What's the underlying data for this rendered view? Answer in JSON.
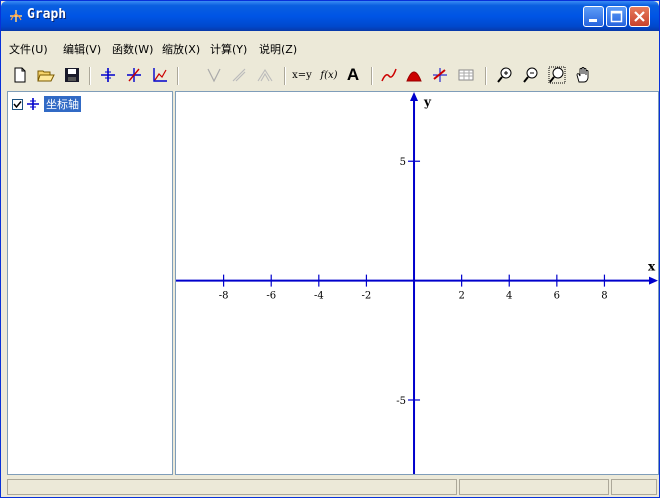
{
  "window": {
    "title": "Graph"
  },
  "menu": [
    "文件(U)",
    "编辑(V)",
    "函数(W)",
    "缩放(X)",
    "计算(Y)",
    "说明(Z)"
  ],
  "toolbar": {
    "tools": [
      "new-file-icon",
      "open-folder-icon",
      "save-icon",
      "axes-icon",
      "insert-function-icon",
      "insert-tangent-icon",
      "shade-icon",
      "inequality-icon",
      "tangent-disabled-icon",
      "series-disabled-icon",
      "xy-label",
      "fx-label",
      "text-icon",
      "trendline-icon",
      "area-icon",
      "point-series-icon",
      "table-icon",
      "zoom-in-icon",
      "zoom-out-icon",
      "zoom-fit-icon",
      "pan-hand-icon"
    ],
    "xy_label": "x=y",
    "fx_label": "f(x)",
    "text_label": "A"
  },
  "tree": {
    "node_label": "坐标轴",
    "checked": true
  },
  "axes": {
    "x_label": "x",
    "y_label": "y",
    "x_ticks": [
      "-8",
      "-6",
      "-4",
      "-2",
      "2",
      "4",
      "6",
      "8"
    ],
    "x_tick_values": [
      -8,
      -6,
      -4,
      -2,
      2,
      4,
      6,
      8
    ],
    "y_ticks": [
      "5",
      "-5"
    ],
    "y_tick_values": [
      5,
      -5
    ],
    "x_range": [
      -10,
      10.25
    ],
    "y_range": [
      -8.1,
      7.9
    ],
    "axis_color": "#0000cc"
  }
}
